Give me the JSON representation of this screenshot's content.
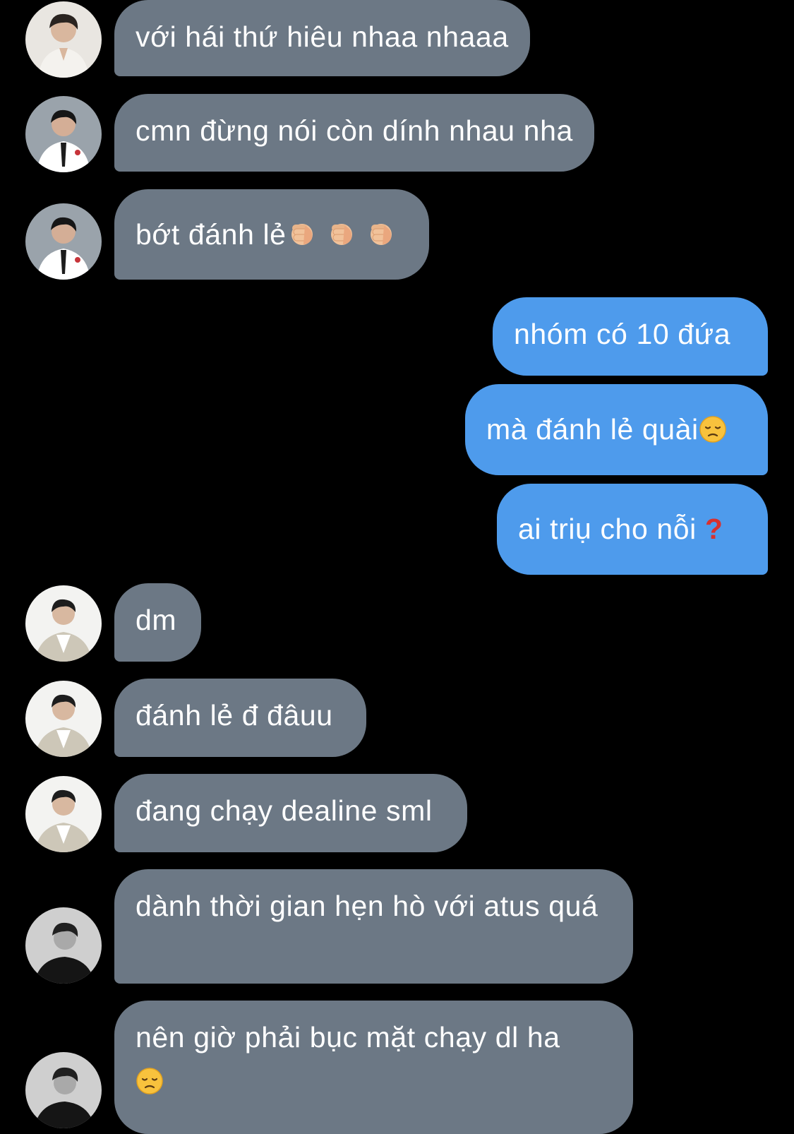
{
  "chat": {
    "messages": [
      {
        "id": "m1",
        "sender": "friend-a",
        "text": "với hái thứ hiêu nhaa nhaaa"
      },
      {
        "id": "m2",
        "sender": "friend-b",
        "text": "cmn đừng nói còn dính nhau nha"
      },
      {
        "id": "m3",
        "sender": "friend-b",
        "text": "bớt đánh lẻ",
        "emojis": [
          "fist-emoji",
          "fist-emoji",
          "fist-emoji"
        ]
      },
      {
        "id": "m4",
        "sender": "me",
        "text": "nhóm có 10 đứa"
      },
      {
        "id": "m5",
        "sender": "me",
        "text": "mà đánh lẻ quài",
        "emojis": [
          "disappointed-face-emoji"
        ]
      },
      {
        "id": "m6",
        "sender": "me",
        "text": "ai triụ cho nỗi",
        "emojis": [
          "red-question-mark-emoji"
        ]
      },
      {
        "id": "m7",
        "sender": "friend-c",
        "text": "dm"
      },
      {
        "id": "m8",
        "sender": "friend-c",
        "text": "đánh lẻ đ đâuu"
      },
      {
        "id": "m9",
        "sender": "friend-c",
        "text": "đang chạy dealine sml"
      },
      {
        "id": "m10",
        "sender": "friend-d",
        "text": "dành thời gian hẹn hò với atus quá"
      },
      {
        "id": "m11",
        "sender": "friend-d",
        "text": "nên giờ phải bục mặt chạy dl ha",
        "emojis": [
          "disappointed-face-emoji"
        ]
      }
    ]
  },
  "emoji_glyphs": {
    "question": "?"
  },
  "colors": {
    "background": "#000000",
    "incoming_bubble": "#6c7885",
    "outgoing_bubble": "#4e9bec",
    "text": "#ffffff",
    "question_mark": "#d8312f"
  }
}
